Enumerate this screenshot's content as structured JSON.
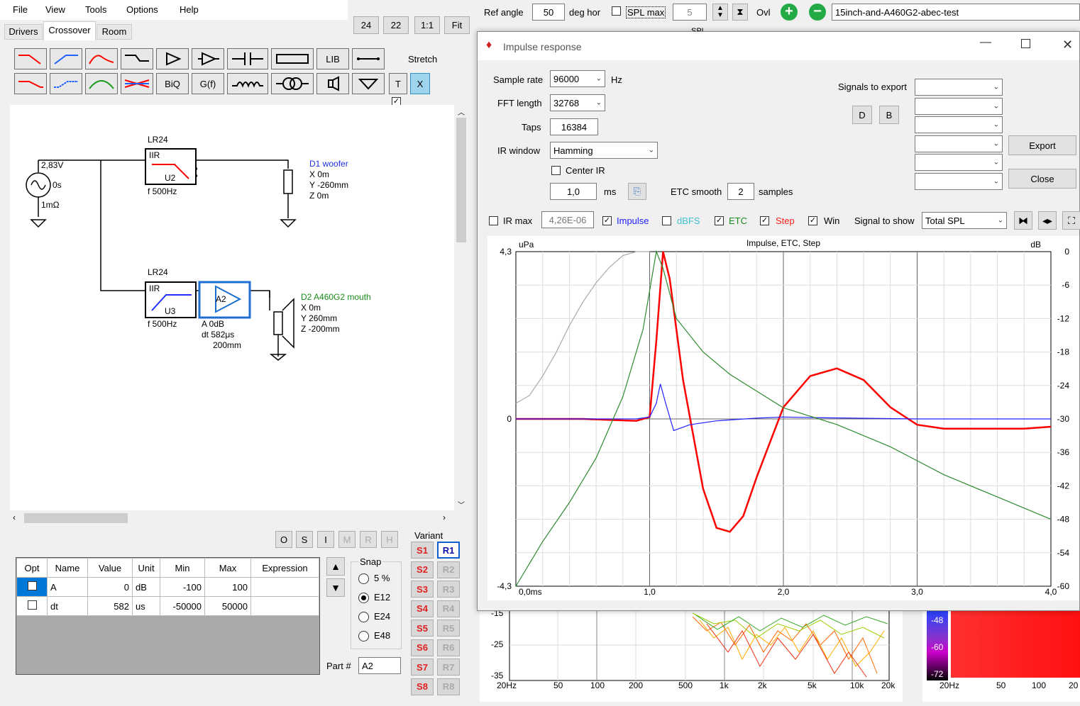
{
  "menu": {
    "file": "File",
    "view": "View",
    "tools": "Tools",
    "options": "Options",
    "help": "Help"
  },
  "tabs": {
    "drivers": "Drivers",
    "crossover": "Crossover",
    "room": "Room"
  },
  "zoom": {
    "b24": "24",
    "b22": "22",
    "b11": "1:1",
    "fit": "Fit"
  },
  "toolbar": {
    "ref_angle_label": "Ref angle",
    "ref_angle": "50",
    "deg_hor": "deg hor",
    "spl_max": "SPL max",
    "spl_value": "5",
    "ovl": "Ovl",
    "project": "15inch-and-A460G2-abec-test"
  },
  "palette": {
    "lib": "LIB",
    "stretch": "Stretch",
    "biq": "BiQ",
    "gf": "G(f)",
    "t": "T",
    "x": "X"
  },
  "schematic": {
    "source_v": "2,83V",
    "source_t": "0s",
    "source_r": "1mΩ",
    "f1_type": "LR24",
    "f1_kind": "IIR",
    "f1_id": "U2",
    "f1_f": "f  500Hz",
    "f2_type": "LR24",
    "f2_kind": "IIR",
    "f2_id": "U3",
    "f2_f": "f  500Hz",
    "amp_id": "A2",
    "amp_a": "A  0dB",
    "amp_dt": "dt 582μs",
    "amp_mm": "200mm",
    "d1_name": "D1 woofer",
    "d1_x": "X 0m",
    "d1_y": "Y -260mm",
    "d1_z": "Z 0m",
    "d2_name": "D2 A460G2 mouth",
    "d2_x": "X 0m",
    "d2_y": "Y 260mm",
    "d2_z": "Z -200mm"
  },
  "osi": [
    "O",
    "S",
    "I",
    "M",
    "R",
    "H"
  ],
  "params": {
    "headers": [
      "Opt",
      "Name",
      "Value",
      "Unit",
      "Min",
      "Max",
      "Expression"
    ],
    "rows": [
      {
        "name": "A",
        "value": "0",
        "unit": "dB",
        "min": "-100",
        "max": "100"
      },
      {
        "name": "dt",
        "value": "582",
        "unit": "us",
        "min": "-50000",
        "max": "50000"
      }
    ]
  },
  "snap": {
    "label": "Snap",
    "o1": "5 %",
    "o2": "E12",
    "o3": "E24",
    "o4": "E48"
  },
  "part": {
    "label": "Part #",
    "value": "A2"
  },
  "variant": {
    "label": "Variant",
    "s": [
      "S1",
      "S2",
      "S3",
      "S4",
      "S5",
      "S6",
      "S7",
      "S8"
    ],
    "r": [
      "R1",
      "R2",
      "R3",
      "R4",
      "R5",
      "R6",
      "R7",
      "R8"
    ]
  },
  "ir": {
    "title": "Impulse response",
    "sample_rate_label": "Sample rate",
    "sample_rate": "96000",
    "hz": "Hz",
    "fft_label": "FFT length",
    "fft": "32768",
    "taps_label": "Taps",
    "taps": "16384",
    "window_label": "IR window",
    "window": "Hamming",
    "center_ir": "Center IR",
    "ms_value": "1,0",
    "ms": "ms",
    "etc_smooth": "ETC smooth",
    "etc_value": "2",
    "samples": "samples",
    "signals_export": "Signals to export",
    "d": "D",
    "b": "B",
    "export": "Export",
    "close": "Close",
    "ir_max": "IR max",
    "ir_max_value": "4,26E-06",
    "impulse": "Impulse",
    "dbfs": "dBFS",
    "etc": "ETC",
    "step": "Step",
    "win": "Win",
    "signal_show": "Signal to show",
    "signal_value": "Total SPL"
  },
  "chart_data": {
    "type": "line",
    "title": "Impulse, ETC, Step",
    "ylabel": "uPa",
    "y2label": "dB",
    "xlim": [
      0,
      4
    ],
    "ylim": [
      -4.3,
      4.3
    ],
    "y2lim": [
      -60,
      0
    ],
    "x_ticks": [
      "0,0ms",
      "1,0",
      "2,0",
      "3,0",
      "4,0"
    ],
    "y_ticks": [
      "4,3",
      "0",
      "-4,3"
    ],
    "y2_ticks": [
      "0",
      "-6",
      "-12",
      "-18",
      "-24",
      "-30",
      "-36",
      "-42",
      "-48",
      "-54",
      "-60"
    ],
    "series": [
      {
        "name": "Step",
        "color": "#ff0000",
        "x": [
          0,
          0.5,
          0.9,
          1.0,
          1.05,
          1.1,
          1.15,
          1.25,
          1.4,
          1.5,
          1.6,
          1.7,
          1.8,
          2.0,
          2.2,
          2.4,
          2.6,
          2.8,
          3.0,
          3.2,
          3.5,
          3.8,
          4.0
        ],
        "y": [
          0,
          0,
          -0.05,
          0.05,
          2.0,
          4.3,
          3.6,
          1.0,
          -1.8,
          -2.8,
          -2.9,
          -2.5,
          -1.5,
          0.3,
          1.1,
          1.3,
          1.0,
          0.3,
          -0.15,
          -0.25,
          -0.25,
          -0.25,
          -0.2
        ]
      },
      {
        "name": "Impulse",
        "color": "#2020ff",
        "x": [
          0,
          0.9,
          1.0,
          1.05,
          1.08,
          1.12,
          1.18,
          1.3,
          1.5,
          1.8,
          2.0,
          2.3,
          3.0,
          4.0
        ],
        "y": [
          0,
          0,
          0.05,
          0.4,
          0.9,
          0.4,
          -0.3,
          -0.15,
          -0.05,
          0.02,
          0.05,
          0.03,
          0,
          0
        ]
      },
      {
        "name": "ETC",
        "color": "#2e8b2e",
        "x": [
          0,
          0.2,
          0.4,
          0.6,
          0.8,
          0.95,
          1.05,
          1.1,
          1.2,
          1.4,
          1.6,
          1.8,
          2.0,
          2.4,
          2.8,
          3.2,
          3.6,
          4.0
        ],
        "y": [
          -60,
          -52,
          -45,
          -37,
          -26,
          -14,
          0,
          -3,
          -12,
          -18,
          -22,
          -25,
          -28,
          -31,
          -35,
          -40,
          -44,
          -48
        ]
      },
      {
        "name": "Win",
        "color": "#aaaaaa",
        "x": [
          0,
          0.1,
          0.2,
          0.3,
          0.4,
          0.5,
          0.6,
          0.7,
          0.8,
          0.9,
          1.0
        ],
        "y": [
          0.4,
          0.6,
          1.1,
          1.7,
          2.4,
          3.0,
          3.5,
          3.9,
          4.2,
          4.3,
          4.3
        ]
      }
    ]
  },
  "spl_bottom": {
    "y_ticks": [
      "-15",
      "-25",
      "-35"
    ],
    "x_ticks": [
      "20Hz",
      "50",
      "100",
      "200",
      "500",
      "1k",
      "2k",
      "5k",
      "10k",
      "20k"
    ]
  },
  "polar_bottom": {
    "y_ticks": [
      "-48",
      "-60",
      "-72"
    ],
    "x_ticks": [
      "20Hz",
      "50",
      "100",
      "20"
    ]
  },
  "spl_top": "SPL"
}
